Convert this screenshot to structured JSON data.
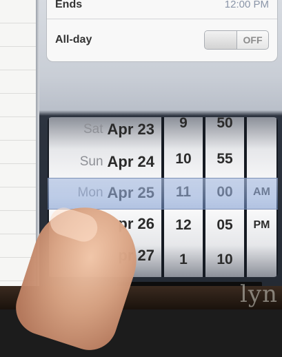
{
  "event_options": {
    "ends": {
      "label": "Ends",
      "value": "12:00 PM"
    },
    "all_day": {
      "label": "All-day",
      "state": "OFF"
    }
  },
  "picker": {
    "dates": [
      {
        "dow": "Sat",
        "md": "Apr 23"
      },
      {
        "dow": "Sun",
        "md": "Apr 24"
      },
      {
        "dow": "Mon",
        "md": "Apr 25"
      },
      {
        "dow": "",
        "md": "Apr 26",
        "visible_text": "pr 26"
      },
      {
        "dow": "",
        "md": "Apr 27",
        "visible_text": "pr 27"
      }
    ],
    "hours": [
      "9",
      "10",
      "11",
      "12",
      "1"
    ],
    "minutes": [
      "50",
      "55",
      "00",
      "05",
      "10"
    ],
    "meridiem": [
      "",
      "",
      "AM",
      "PM",
      ""
    ],
    "selected": {
      "date": "Mon Apr 25",
      "hour": "11",
      "minute": "00",
      "meridiem": "AM"
    }
  },
  "watermark": "lyn"
}
